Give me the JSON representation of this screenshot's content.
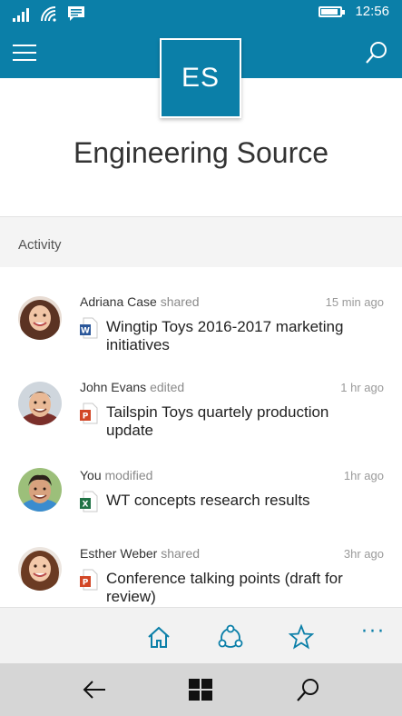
{
  "status": {
    "time": "12:56",
    "battery_level": 0.9
  },
  "header": {
    "menu_icon": "hamburger-icon",
    "search_icon": "search-icon"
  },
  "site": {
    "initials": "ES",
    "title": "Engineering Source"
  },
  "section": {
    "label": "Activity"
  },
  "activities": [
    {
      "user": "Adriana Case",
      "action": "shared",
      "time": "15 min ago",
      "doc_type": "word",
      "doc_title": "Wingtip Toys 2016-2017 marketing initiatives"
    },
    {
      "user": "John Evans",
      "action": "edited",
      "time": "1 hr ago",
      "doc_type": "powerpoint",
      "doc_title": "Tailspin Toys quartely production update"
    },
    {
      "user": "You",
      "action": "modified",
      "time": "1hr ago",
      "doc_type": "excel",
      "doc_title": "WT concepts research results"
    },
    {
      "user": "Esther Weber",
      "action": "shared",
      "time": "3hr ago",
      "doc_type": "powerpoint",
      "doc_title": "Conference talking points (draft for review)"
    }
  ],
  "bottom_nav": {
    "home_icon": "home-icon",
    "groups_icon": "groups-icon",
    "favorites_icon": "star-icon",
    "more_label": "···"
  },
  "colors": {
    "accent": "#0b7fa8",
    "word": "#2b579a",
    "powerpoint": "#d24726",
    "excel": "#217346"
  }
}
